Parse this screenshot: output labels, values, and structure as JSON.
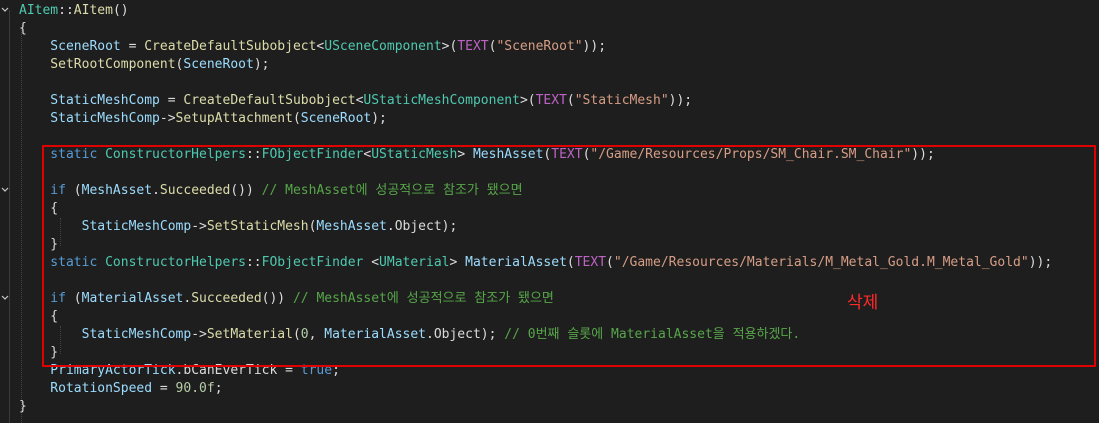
{
  "colors": {
    "background": "#1e1e1e",
    "highlight_box": "#e00000",
    "annotation": "#ff2a2a"
  },
  "annotation": {
    "text": "삭제"
  },
  "code_lines": [
    {
      "tokens": [
        [
          "AItem",
          "c-type"
        ],
        [
          "::",
          "c-def"
        ],
        [
          "AItem",
          "c-fn"
        ],
        [
          "()",
          "c-def"
        ]
      ]
    },
    {
      "tokens": [
        [
          "{",
          "c-def"
        ]
      ]
    },
    {
      "tokens": [
        [
          "    SceneRoot",
          "c-var"
        ],
        [
          " = ",
          "c-def"
        ],
        [
          "CreateDefaultSubobject",
          "c-fn"
        ],
        [
          "<",
          "c-def"
        ],
        [
          "USceneComponent",
          "c-type"
        ],
        [
          ">(",
          "c-def"
        ],
        [
          "TEXT",
          "c-macro"
        ],
        [
          "(",
          "c-def"
        ],
        [
          "\"SceneRoot\"",
          "c-str"
        ],
        [
          "));",
          "c-def"
        ]
      ]
    },
    {
      "tokens": [
        [
          "    SetRootComponent",
          "c-fn"
        ],
        [
          "(",
          "c-def"
        ],
        [
          "SceneRoot",
          "c-var"
        ],
        [
          ");",
          "c-def"
        ]
      ]
    },
    {
      "tokens": [
        [
          "",
          "c-def"
        ]
      ]
    },
    {
      "tokens": [
        [
          "    StaticMeshComp",
          "c-var"
        ],
        [
          " = ",
          "c-def"
        ],
        [
          "CreateDefaultSubobject",
          "c-fn"
        ],
        [
          "<",
          "c-def"
        ],
        [
          "UStaticMeshComponent",
          "c-type"
        ],
        [
          ">(",
          "c-def"
        ],
        [
          "TEXT",
          "c-macro"
        ],
        [
          "(",
          "c-def"
        ],
        [
          "\"StaticMesh\"",
          "c-str"
        ],
        [
          "));",
          "c-def"
        ]
      ]
    },
    {
      "tokens": [
        [
          "    StaticMeshComp",
          "c-var"
        ],
        [
          "->",
          "c-def"
        ],
        [
          "SetupAttachment",
          "c-fn"
        ],
        [
          "(",
          "c-def"
        ],
        [
          "SceneRoot",
          "c-var"
        ],
        [
          ");",
          "c-def"
        ]
      ]
    },
    {
      "tokens": [
        [
          "",
          "c-def"
        ]
      ]
    },
    {
      "tokens": [
        [
          "    static ",
          "c-kw"
        ],
        [
          "ConstructorHelpers",
          "c-type"
        ],
        [
          "::",
          "c-def"
        ],
        [
          "FObjectFinder",
          "c-type"
        ],
        [
          "<",
          "c-def"
        ],
        [
          "UStaticMesh",
          "c-type"
        ],
        [
          "> ",
          "c-def"
        ],
        [
          "MeshAsset",
          "c-var"
        ],
        [
          "(",
          "c-def"
        ],
        [
          "TEXT",
          "c-macro"
        ],
        [
          "(",
          "c-def"
        ],
        [
          "\"/Game/Resources/Props/SM_Chair.SM_Chair\"",
          "c-str"
        ],
        [
          "));",
          "c-def"
        ]
      ]
    },
    {
      "tokens": [
        [
          "",
          "c-def"
        ]
      ]
    },
    {
      "tokens": [
        [
          "    if ",
          "c-kw"
        ],
        [
          "(",
          "c-def"
        ],
        [
          "MeshAsset",
          "c-var"
        ],
        [
          ".",
          "c-def"
        ],
        [
          "Succeeded",
          "c-fn"
        ],
        [
          "()) ",
          "c-def"
        ],
        [
          "// MeshAsset에 성공적으로 참조가 됐으면",
          "c-com"
        ]
      ]
    },
    {
      "tokens": [
        [
          "    {",
          "c-def"
        ]
      ]
    },
    {
      "tokens": [
        [
          "        StaticMeshComp",
          "c-var"
        ],
        [
          "->",
          "c-def"
        ],
        [
          "SetStaticMesh",
          "c-fn"
        ],
        [
          "(",
          "c-def"
        ],
        [
          "MeshAsset",
          "c-var"
        ],
        [
          ".",
          "c-def"
        ],
        [
          "Object",
          "c-field"
        ],
        [
          ");",
          "c-def"
        ]
      ]
    },
    {
      "tokens": [
        [
          "    }",
          "c-def"
        ]
      ]
    },
    {
      "tokens": [
        [
          "    static ",
          "c-kw"
        ],
        [
          "ConstructorHelpers",
          "c-type"
        ],
        [
          "::",
          "c-def"
        ],
        [
          "FObjectFinder ",
          "c-type"
        ],
        [
          "<",
          "c-def"
        ],
        [
          "UMaterial",
          "c-type"
        ],
        [
          "> ",
          "c-def"
        ],
        [
          "MaterialAsset",
          "c-var"
        ],
        [
          "(",
          "c-def"
        ],
        [
          "TEXT",
          "c-macro"
        ],
        [
          "(",
          "c-def"
        ],
        [
          "\"/Game/Resources/Materials/M_Metal_Gold.M_Metal_Gold\"",
          "c-str"
        ],
        [
          "));",
          "c-def"
        ]
      ]
    },
    {
      "tokens": [
        [
          "",
          "c-def"
        ]
      ]
    },
    {
      "tokens": [
        [
          "    if ",
          "c-kw"
        ],
        [
          "(",
          "c-def"
        ],
        [
          "MaterialAsset",
          "c-var"
        ],
        [
          ".",
          "c-def"
        ],
        [
          "Succeeded",
          "c-fn"
        ],
        [
          "()) ",
          "c-def"
        ],
        [
          "// MeshAsset에 성공적으로 참조가 됐으면",
          "c-com"
        ]
      ]
    },
    {
      "tokens": [
        [
          "    {",
          "c-def"
        ]
      ]
    },
    {
      "tokens": [
        [
          "        StaticMeshComp",
          "c-var"
        ],
        [
          "->",
          "c-def"
        ],
        [
          "SetMaterial",
          "c-fn"
        ],
        [
          "(",
          "c-def"
        ],
        [
          "0",
          "c-num"
        ],
        [
          ", ",
          "c-def"
        ],
        [
          "MaterialAsset",
          "c-var"
        ],
        [
          ".",
          "c-def"
        ],
        [
          "Object",
          "c-field"
        ],
        [
          "); ",
          "c-def"
        ],
        [
          "// 0번째 슬롯에 MaterialAsset을 적용하겠다.",
          "c-com"
        ]
      ]
    },
    {
      "tokens": [
        [
          "    }",
          "c-def"
        ]
      ]
    },
    {
      "tokens": [
        [
          "    PrimaryActorTick",
          "c-var"
        ],
        [
          ".",
          "c-def"
        ],
        [
          "bCanEverTick",
          "c-field"
        ],
        [
          " = ",
          "c-def"
        ],
        [
          "true",
          "c-kw"
        ],
        [
          ";",
          "c-def"
        ]
      ]
    },
    {
      "tokens": [
        [
          "    RotationSpeed",
          "c-var"
        ],
        [
          " = ",
          "c-def"
        ],
        [
          "90.0f",
          "c-num"
        ],
        [
          ";",
          "c-def"
        ]
      ]
    },
    {
      "tokens": [
        [
          "}",
          "c-def"
        ]
      ]
    }
  ]
}
